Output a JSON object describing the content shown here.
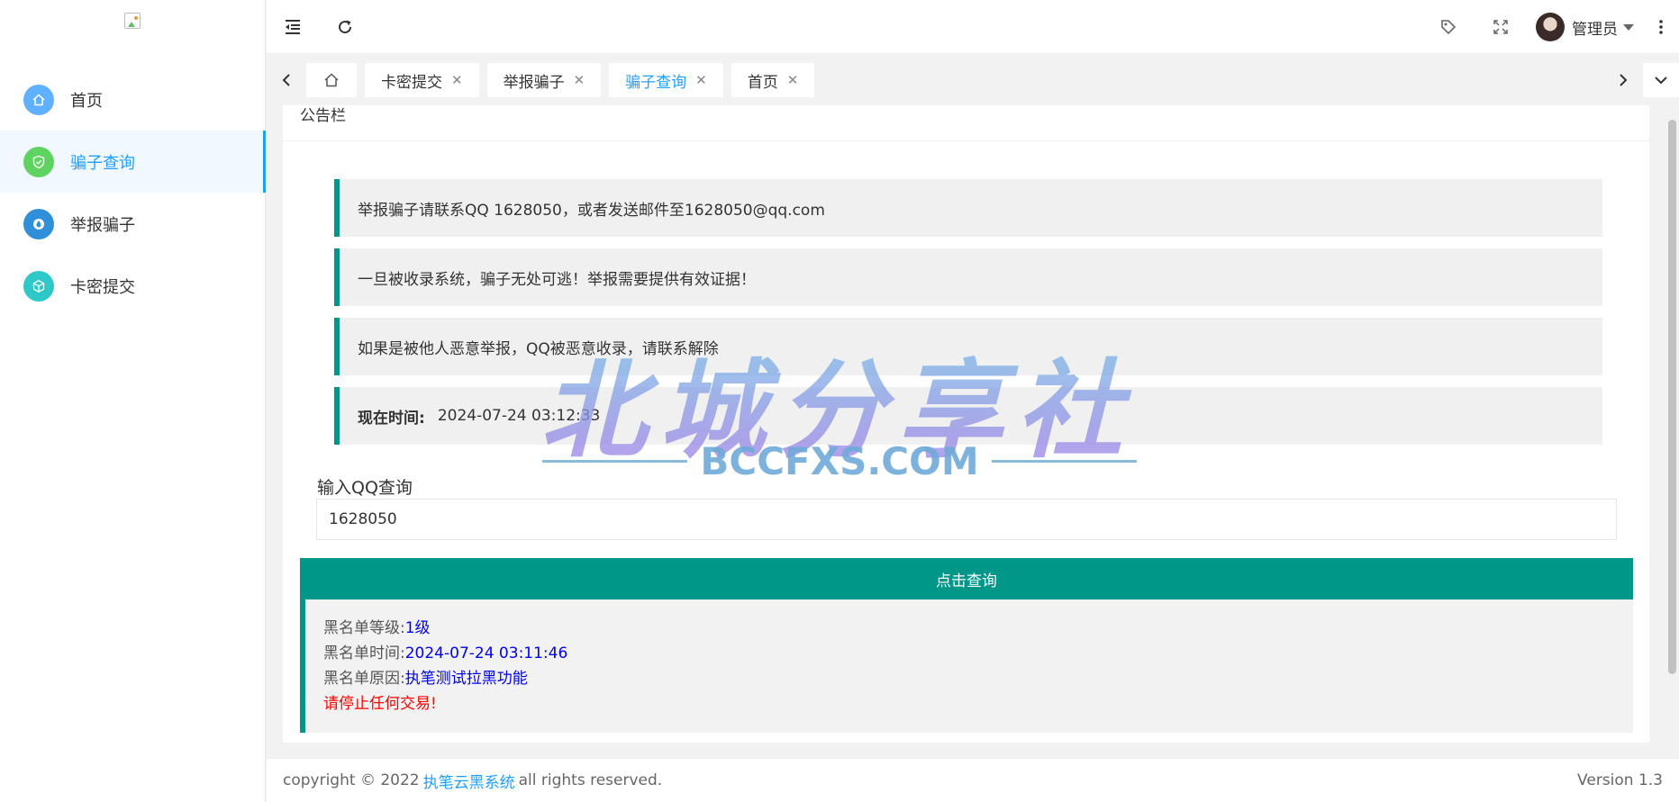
{
  "sidebar": {
    "items": [
      {
        "label": "首页",
        "icon": "home-icon",
        "color": "#5fb0ff"
      },
      {
        "label": "骗子查询",
        "icon": "shield-icon",
        "color": "#5fd35f"
      },
      {
        "label": "举报骗子",
        "icon": "drop-icon",
        "color": "#2f8fd8"
      },
      {
        "label": "卡密提交",
        "icon": "box-icon",
        "color": "#2ec8c8"
      }
    ],
    "active_index": 1
  },
  "header": {
    "user_name": "管理员"
  },
  "tabs": {
    "items": [
      {
        "label": "卡密提交"
      },
      {
        "label": "举报骗子"
      },
      {
        "label": "骗子查询"
      },
      {
        "label": "首页"
      }
    ],
    "active_index": 2,
    "close_glyph": "✕"
  },
  "main": {
    "card_title": "公告栏",
    "notices": [
      "举报骗子请联系QQ 1628050，或者发送邮件至1628050@qq.com",
      "一旦被收录系统，骗子无处可逃！举报需要提供有效证据！",
      "如果是被他人恶意举报，QQ被恶意收录，请联系解除"
    ],
    "time_label": "现在时间:",
    "time_value": "2024-07-24 03:12:33",
    "query_label": "输入QQ查询",
    "query_value": "1628050",
    "query_button": "点击查询",
    "result": {
      "level_key": "黑名单等级:",
      "level_value": "1级",
      "time_key": "黑名单时间:",
      "time_value": "2024-07-24 03:11:46",
      "reason_key": "黑名单原因:",
      "reason_value": "执笔测试拉黑功能",
      "warning": "请停止任何交易!"
    }
  },
  "footer": {
    "copyright_prefix": "copyright © 2022",
    "brand_link": "执笔云黑系统",
    "copyright_suffix": "all rights reserved.",
    "version": "Version 1.3"
  },
  "watermark": {
    "title": "北城分享社",
    "subtitle": "BCCFXS.COM"
  },
  "colors": {
    "accent": "#009688",
    "link": "#1e9fff",
    "result_value": "#0000ee",
    "warning": "#ff0000"
  }
}
